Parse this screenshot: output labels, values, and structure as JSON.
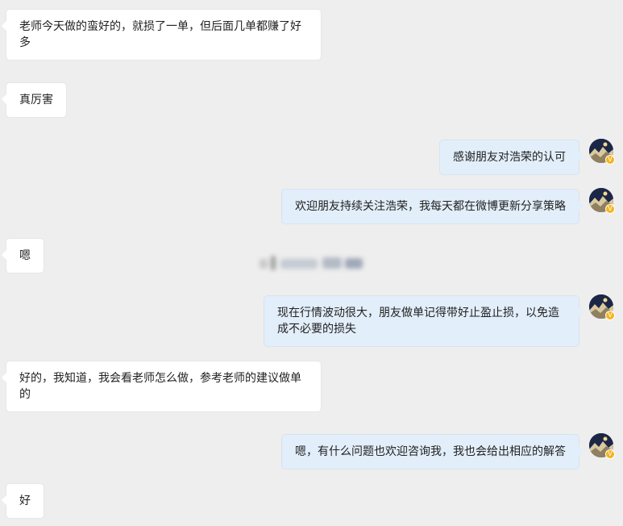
{
  "messages": [
    {
      "side": "in",
      "text": "老师今天做的蛮好的，就损了一单，但后面几单都赚了好多"
    },
    {
      "side": "in",
      "text": "真厉害"
    },
    {
      "side": "out",
      "text": "感谢朋友对浩荣的认可"
    },
    {
      "side": "out",
      "text": "欢迎朋友持续关注浩荣，我每天都在微博更新分享策略"
    },
    {
      "side": "in",
      "text": "嗯"
    },
    {
      "side": "out",
      "text": "现在行情波动很大，朋友做单记得带好止盈止损，以免造成不必要的损失"
    },
    {
      "side": "in",
      "text": "好的，我知道，我会看老师怎么做，参考老师的建议做单的"
    },
    {
      "side": "out",
      "text": "嗯，有什么问题也欢迎咨询我，我也会给出相应的解答"
    },
    {
      "side": "in",
      "text": "好"
    }
  ],
  "avatar": {
    "icon": "landscape-avatar-icon",
    "badge_icon": "verified-v-icon",
    "badge_text": "V"
  },
  "colors": {
    "background": "#eeeeee",
    "incoming_bubble": "#ffffff",
    "outgoing_bubble": "#e2eef9",
    "text": "#222222",
    "badge": "#f5b41d"
  }
}
